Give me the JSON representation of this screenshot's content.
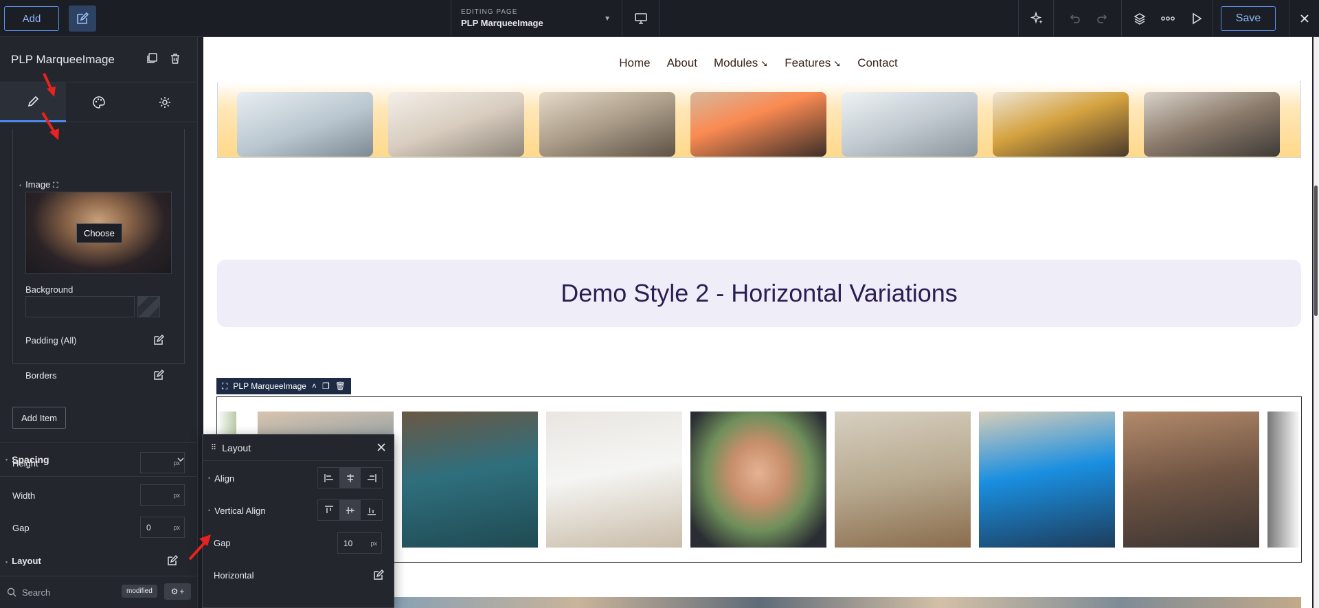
{
  "topbar": {
    "add_label": "Add",
    "editing_label": "EDITING PAGE",
    "page_name": "PLP MarqueeImage",
    "save_label": "Save"
  },
  "left_panel": {
    "title": "PLP MarqueeImage",
    "image_label": "Image",
    "choose_label": "Choose",
    "background_label": "Background",
    "padding_label": "Padding (All)",
    "borders_label": "Borders",
    "add_item_label": "Add Item",
    "spacing_label": "Spacing",
    "height_label": "Height",
    "height_unit": "px",
    "width_label": "Width",
    "width_unit": "px",
    "gap_label": "Gap",
    "gap_value": "0",
    "gap_unit": "px",
    "layout_label": "Layout",
    "search_placeholder": "Search",
    "modified_badge": "modified"
  },
  "canvas": {
    "nav": {
      "home": "Home",
      "about": "About",
      "modules": "Modules",
      "features": "Features",
      "contact": "Contact"
    },
    "title": "Demo Style 2 - Horizontal Variations",
    "module_tag": "PLP MarqueeImage"
  },
  "layout_popup": {
    "title": "Layout",
    "align_label": "Align",
    "valign_label": "Vertical Align",
    "gap_label": "Gap",
    "gap_value": "10",
    "gap_unit": "px",
    "horizontal_label": "Horizontal"
  },
  "colors": {
    "accent": "#4c8bf5",
    "panel_bg": "#23262d",
    "title_text": "#2a1e52",
    "annotation_arrow": "#e8231f"
  }
}
